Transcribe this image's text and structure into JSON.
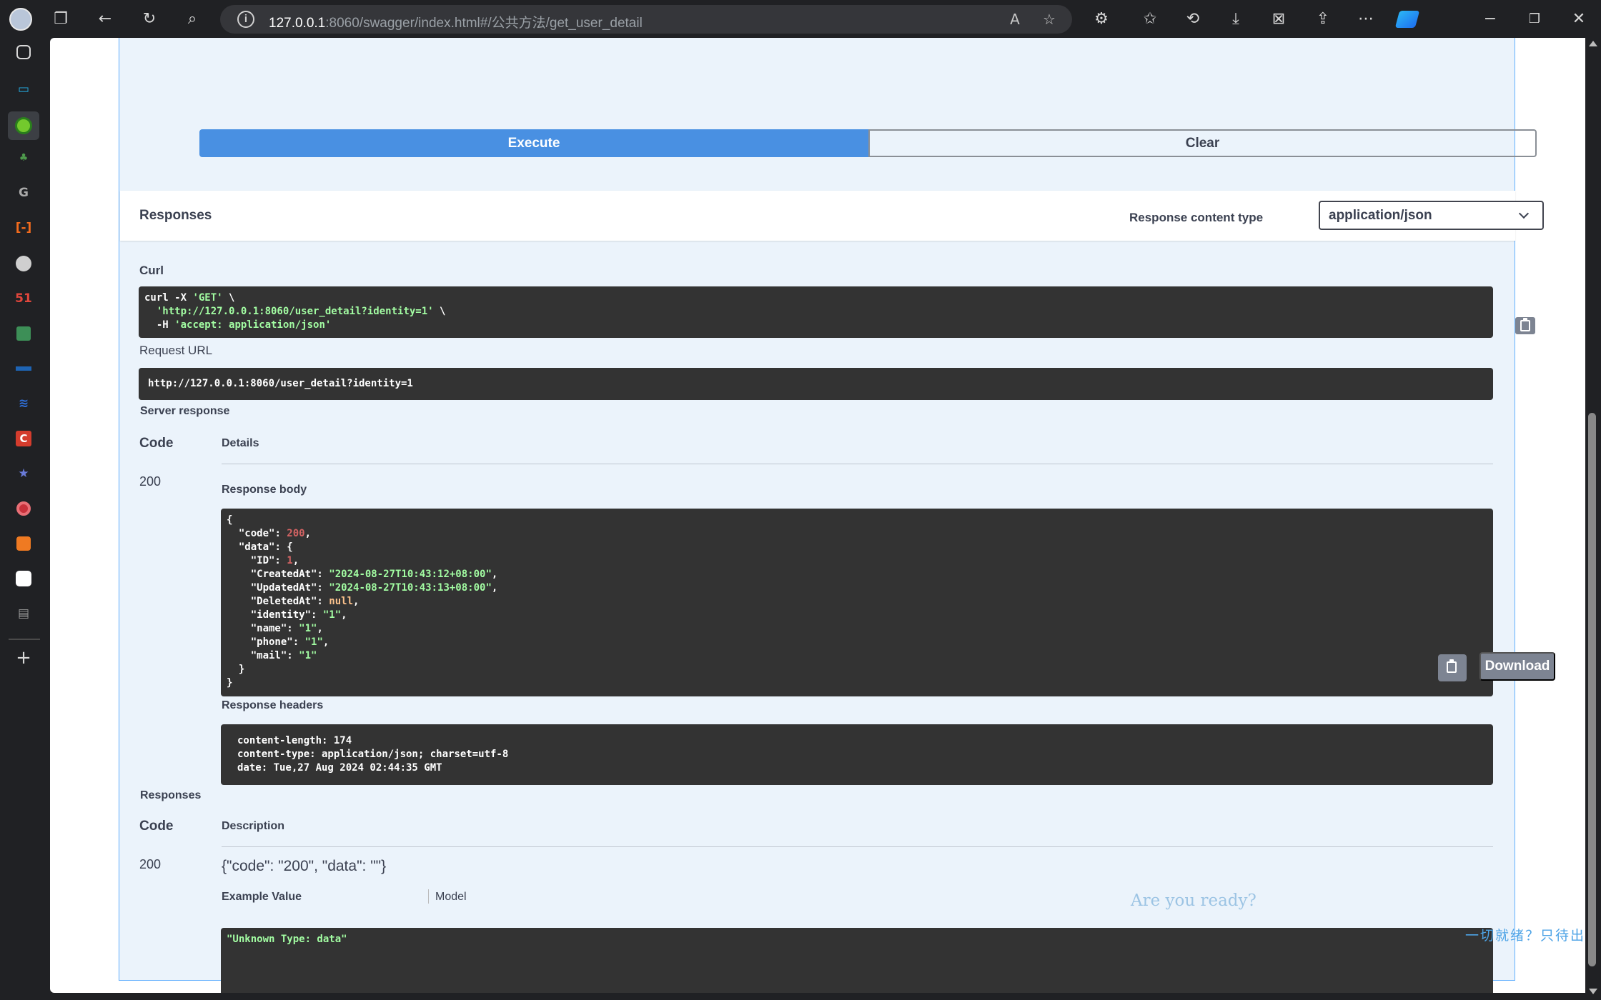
{
  "browser": {
    "url_host": "127.0.0.1",
    "url_rest": ":8060/swagger/index.html#/公共方法/get_user_detail",
    "read_aloud_label": "A",
    "sidebar_badge": "51"
  },
  "actions": {
    "execute_label": "Execute",
    "clear_label": "Clear"
  },
  "responses_header": {
    "title": "Responses",
    "content_type_label": "Response content type",
    "content_type_value": "application/json"
  },
  "curl": {
    "label": "Curl",
    "line1_cmd": "curl -X ",
    "line1_method": "'GET'",
    "line1_end": " \\",
    "line2_indent": "  ",
    "line2_url": "'http://127.0.0.1:8060/user_detail?identity=1'",
    "line2_end": " \\",
    "line3_flag": "  -H ",
    "line3_header": "'accept: application/json'"
  },
  "request_url": {
    "label": "Request URL",
    "value": "http://127.0.0.1:8060/user_detail?identity=1"
  },
  "server_response": {
    "label": "Server response",
    "code_header": "Code",
    "details_header": "Details",
    "code": "200",
    "body_label": "Response body",
    "body": {
      "code": 200,
      "ID": 1,
      "CreatedAt": "2024-08-27T10:43:12+08:00",
      "UpdatedAt": "2024-08-27T10:43:13+08:00",
      "DeletedAt": "null",
      "identity": "1",
      "name": "1",
      "phone": "1",
      "mail": "1"
    },
    "download_label": "Download",
    "headers_label": "Response headers",
    "headers": [
      "content-length: 174",
      "content-type: application/json; charset=utf-8",
      "date: Tue,27 Aug 2024 02:44:35 GMT"
    ]
  },
  "responses_docs": {
    "label": "Responses",
    "code_header": "Code",
    "description_header": "Description",
    "code": "200",
    "description": "{\"code\": \"200\", \"data\": \"\"}",
    "example_value_tab": "Example Value",
    "model_tab": "Model",
    "example": "\"Unknown Type: data\""
  },
  "overlay": {
    "ready_text": "Are you ready?",
    "ready_cn": "一切就绪？只待出发?"
  },
  "colors": {
    "execute": "#4990e2",
    "opblock_bg": "#ebf3fb",
    "code_bg": "#333333",
    "string": "#a2fca2",
    "number": "#d36363"
  }
}
